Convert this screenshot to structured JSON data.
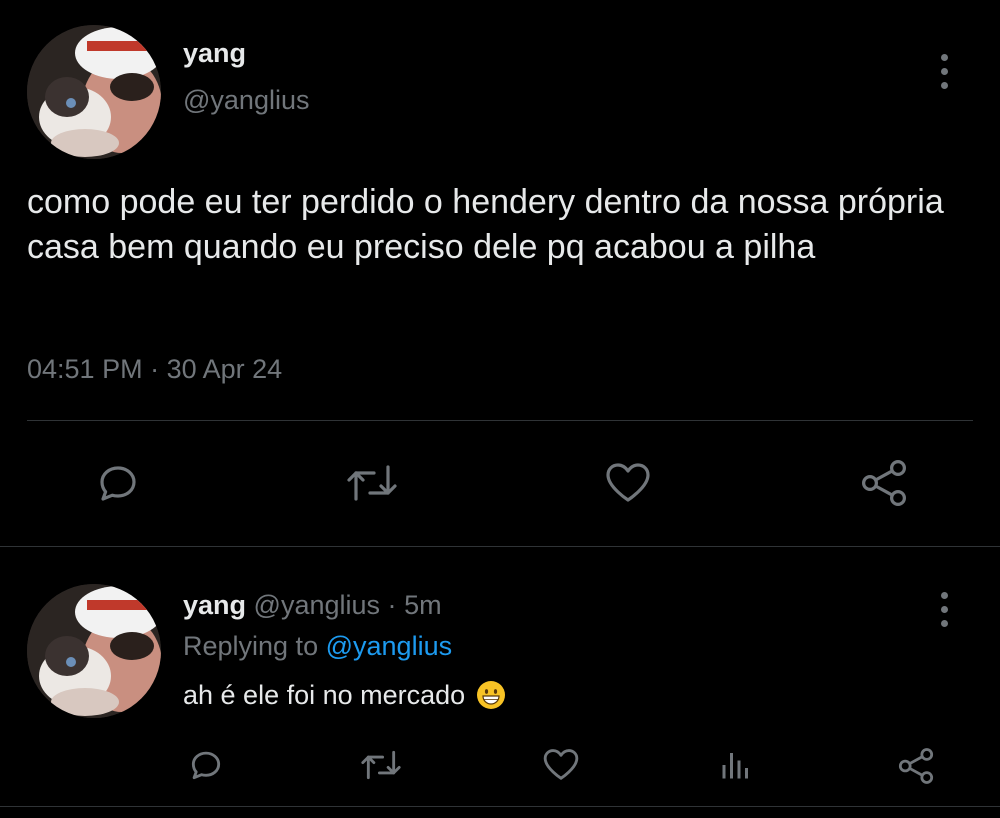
{
  "main_tweet": {
    "display_name": "yang",
    "handle": "@yanglius",
    "text": "como pode eu ter perdido o hendery dentro da nossa própria casa bem quando eu preciso dele pq acabou a pilha",
    "time": "04:51 PM",
    "date": "30 Apr 24",
    "separator": "·",
    "actions": [
      "reply-icon",
      "retweet-icon",
      "like-icon",
      "share-icon"
    ]
  },
  "reply_tweet": {
    "display_name": "yang",
    "handle": "@yanglius",
    "age": "5m",
    "separator": "·",
    "replying_prefix": "Replying to",
    "replying_to": "@yanglius",
    "text": "ah é ele foi no mercado",
    "emoji": "grinning-face-emoji",
    "actions": [
      "reply-icon",
      "retweet-icon",
      "like-icon",
      "analytics-icon",
      "share-icon"
    ]
  },
  "colors": {
    "background": "#000000",
    "text": "#e7e9ea",
    "muted": "#71767b",
    "link": "#1d9bf0",
    "divider": "#2f3336"
  }
}
